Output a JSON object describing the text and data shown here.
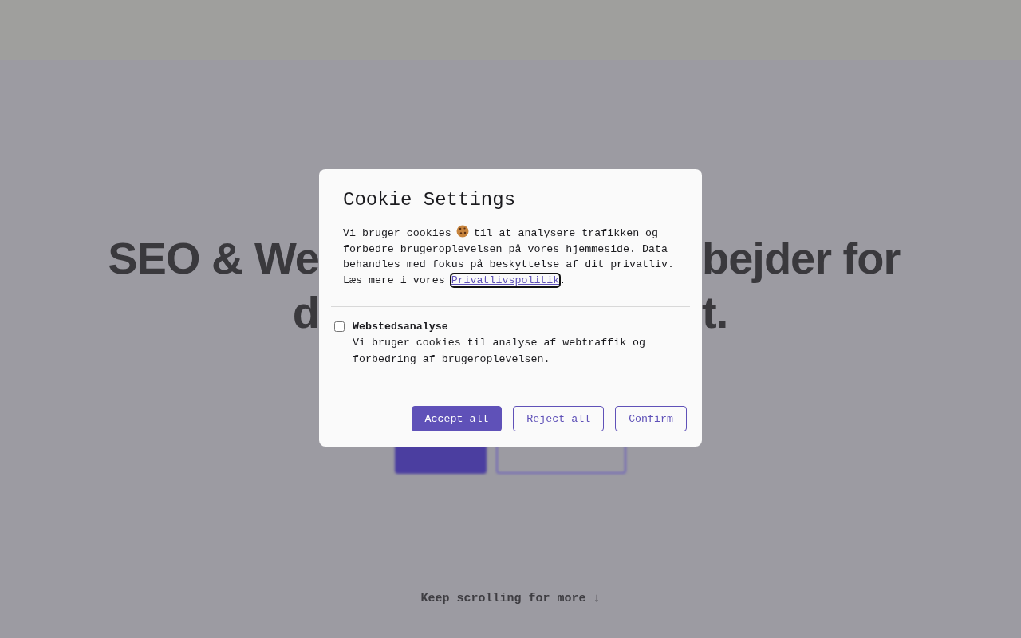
{
  "backdrop": {
    "heading_lines": [
      [
        "SEO & We",
        "bejder for"
      ],
      [
        "d",
        "t."
      ]
    ],
    "buttons": [
      {
        "kind": "primary"
      },
      {
        "kind": "outline"
      }
    ],
    "scroll_hint": "Keep scrolling for more ↓"
  },
  "dialog": {
    "title": "Cookie Settings",
    "intro": [
      "Vi bruger cookies",
      "til at analysere trafikken og forbedre brugeroplevelsen på vores hjemmeside. Data behandles med fokus på beskyttelse af dit privatliv. Læs mere i vores"
    ],
    "link": "Privatlivspolitik",
    "after_link": ".",
    "options": [
      {
        "label": "Webstedsanalyse",
        "description": "Vi bruger cookies til analyse af webtraffik og forbedring af brugeroplevelsen.",
        "checked": false
      }
    ],
    "buttons": [
      {
        "label": "Accept all",
        "kind": "primary"
      },
      {
        "label": "Reject all",
        "kind": "outline"
      },
      {
        "label": "Confirm",
        "kind": "outline"
      }
    ]
  }
}
